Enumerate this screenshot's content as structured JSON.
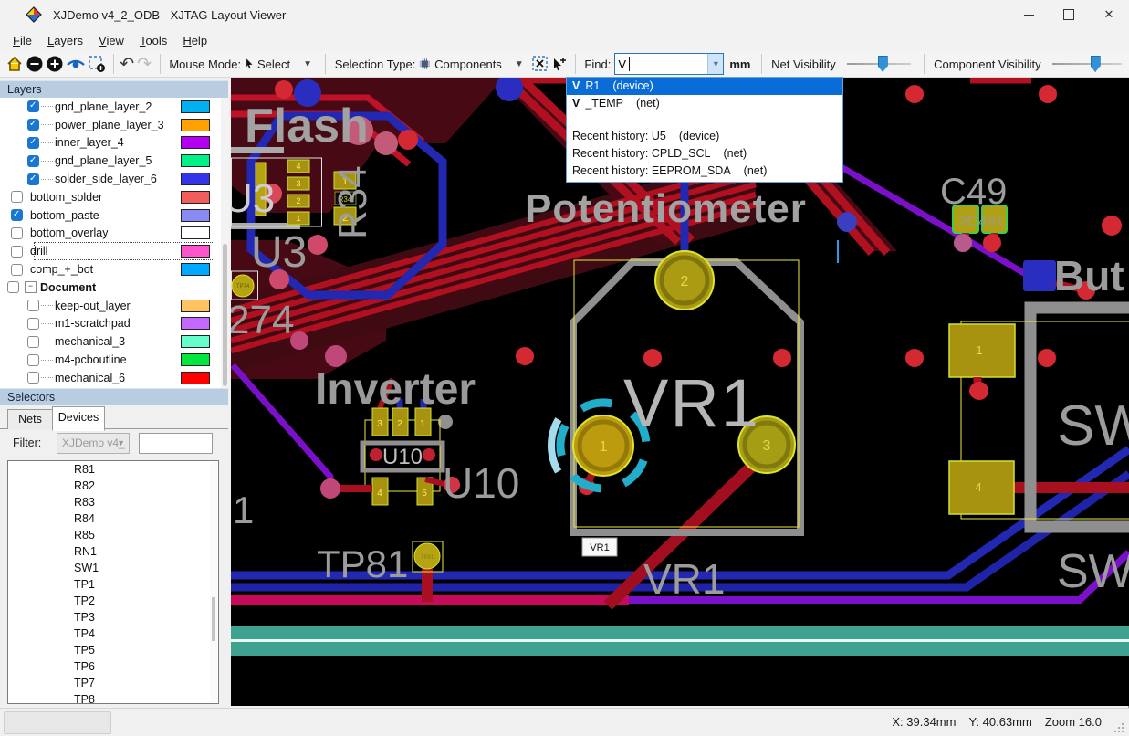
{
  "window": {
    "title": "XJDemo v4_2_ODB - XJTAG Layout Viewer"
  },
  "menu": {
    "items": [
      "File",
      "Layers",
      "View",
      "Tools",
      "Help"
    ]
  },
  "toolbar": {
    "mouse_mode_label": "Mouse Mode:",
    "mouse_mode_value": "Select",
    "selection_type_label": "Selection Type:",
    "selection_type_value": "Components",
    "find_label": "Find:",
    "find_value": "V",
    "units": "mm",
    "net_visibility_label": "Net Visibility",
    "net_visibility_percent": 48,
    "component_visibility_label": "Component Visibility",
    "component_visibility_percent": 55
  },
  "find_dropdown": {
    "results": [
      {
        "prefix": "V",
        "name": "R1",
        "kind": "(device)",
        "selected": true
      },
      {
        "prefix": "V",
        "name": "_TEMP",
        "kind": "(net)",
        "selected": false
      }
    ],
    "history": [
      {
        "label": "Recent history: U5",
        "kind": "(device)"
      },
      {
        "label": "Recent history: CPLD_SCL",
        "kind": "(net)"
      },
      {
        "label": "Recent history: EEPROM_SDA",
        "kind": "(net)"
      }
    ]
  },
  "layers_panel": {
    "title": "Layers",
    "items": [
      {
        "label": "gnd_plane_layer_2",
        "checked": true,
        "indent": true,
        "color": "#00b0f0"
      },
      {
        "label": "power_plane_layer_3",
        "checked": true,
        "indent": true,
        "color": "#ffa200"
      },
      {
        "label": "inner_layer_4",
        "checked": true,
        "indent": true,
        "color": "#b400f2"
      },
      {
        "label": "gnd_plane_layer_5",
        "checked": true,
        "indent": true,
        "color": "#00f287"
      },
      {
        "label": "solder_side_layer_6",
        "checked": true,
        "indent": true,
        "color": "#3434e8"
      },
      {
        "label": "bottom_solder",
        "checked": false,
        "indent": false,
        "color": "#f25c5c"
      },
      {
        "label": "bottom_paste",
        "checked": true,
        "indent": false,
        "color": "#8a8af5"
      },
      {
        "label": "bottom_overlay",
        "checked": false,
        "indent": false,
        "color": "#ffffff"
      },
      {
        "label": "drill",
        "checked": false,
        "indent": false,
        "color": "#ff55cc",
        "focused": true
      },
      {
        "label": "comp_+_bot",
        "checked": false,
        "indent": false,
        "color": "#00a8ff"
      },
      {
        "label": "Document",
        "checked": false,
        "group": true
      },
      {
        "label": "keep-out_layer",
        "checked": false,
        "indent": true,
        "color": "#ffc461"
      },
      {
        "label": "m1-scratchpad",
        "checked": false,
        "indent": true,
        "color": "#c468ff"
      },
      {
        "label": "mechanical_3",
        "checked": false,
        "indent": true,
        "color": "#66ffcc"
      },
      {
        "label": "m4-pcboutline",
        "checked": false,
        "indent": true,
        "color": "#00e63c"
      },
      {
        "label": "mechanical_6",
        "checked": false,
        "indent": true,
        "color": "#ff0000"
      },
      {
        "label": "",
        "checked": false,
        "indent": true,
        "color": "#3434e8"
      }
    ]
  },
  "selectors_panel": {
    "title": "Selectors",
    "tabs": {
      "nets": "Nets",
      "devices": "Devices"
    },
    "filter_label": "Filter:",
    "filter_value": "XJDemo v4_",
    "filter_text": "",
    "devices": [
      "R81",
      "R82",
      "R83",
      "R84",
      "R85",
      "RN1",
      "SW1",
      "TP1",
      "TP2",
      "TP3",
      "TP4",
      "TP5",
      "TP6",
      "TP7",
      "TP8"
    ]
  },
  "status_bar": {
    "x": "X: 39.34mm",
    "y": "Y: 40.63mm",
    "zoom": "Zoom 16.0"
  },
  "canvas": {
    "silkscreen": {
      "flash": "Flash",
      "potentiometer": "Potentiometer",
      "c49": "C49",
      "button_partial": "But",
      "u3_a": "U3",
      "u3_b": "U3",
      "r34_vertical": "R34",
      "r74_partial": "274",
      "inverter": "Inverter",
      "u10_large": "U10",
      "u10_box": "U10",
      "tp81": "TP81",
      "vr1_center": "VR1",
      "vr1_lower": "VR1",
      "sw_upper": "SW",
      "sw_lower": "SW",
      "p1_partial": "1"
    },
    "pads": {
      "vr1_1": "1",
      "vr1_2": "2",
      "vr1_3": "3",
      "u10_1": "1",
      "u10_2": "2",
      "u10_3": "3",
      "u10_4": "4",
      "u10_5": "5",
      "sw_1": "1",
      "sw_4": "4",
      "u3_1": "1",
      "u3_2": "2",
      "u3_3": "3",
      "u3_4": "4",
      "r34_1": "1",
      "r34_2": "2",
      "r34_label": "R34",
      "c49_label": "2C491",
      "tp74_pad": "TP74",
      "tp81_pad": "TP81"
    },
    "tooltip": "VR1",
    "colors": {
      "accent_selection": "#0a6cd6",
      "silkscreen": "#9c9c9c",
      "pad_fill": "#a89310",
      "pad_border": "#d9e22e",
      "trace_red": "#b01020",
      "trace_blue": "#2228b2",
      "trace_purple": "#7a10c8",
      "trace_magenta": "#c80a5a",
      "board_teal": "#3fa190",
      "via_red": "#d42832"
    }
  }
}
